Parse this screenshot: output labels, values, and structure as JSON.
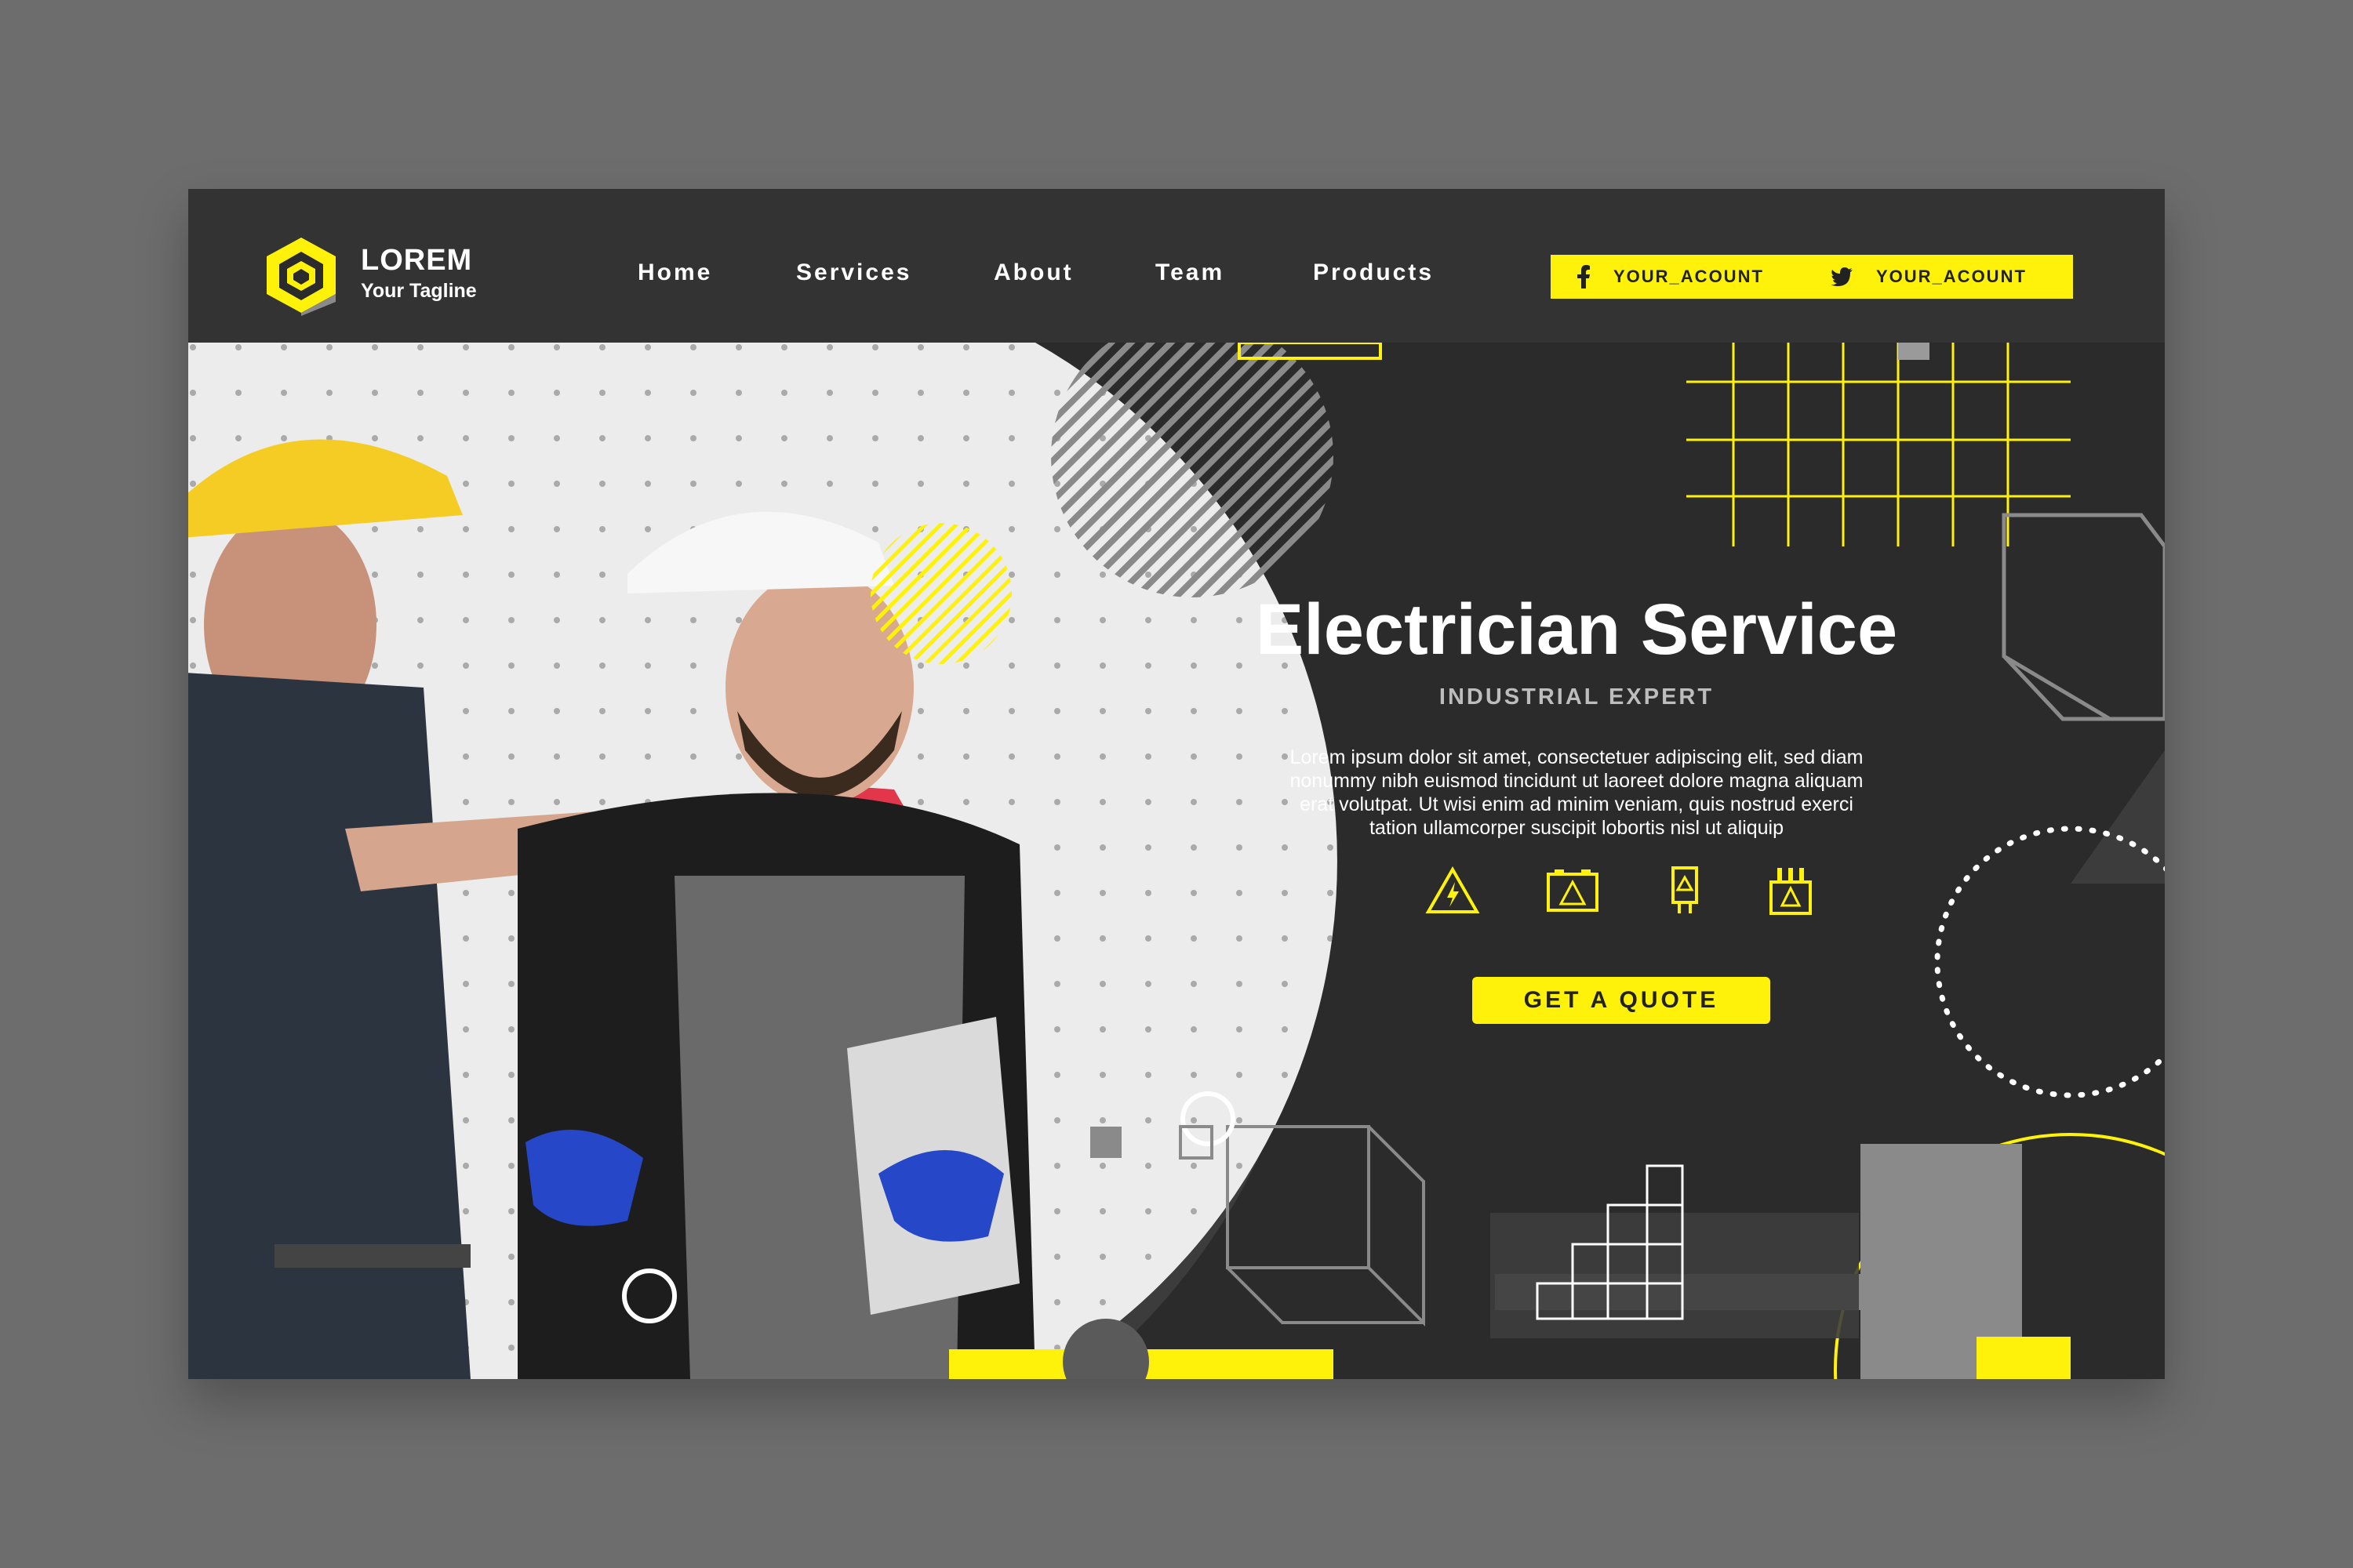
{
  "brand": {
    "name": "LOREM",
    "tagline": "Your Tagline"
  },
  "nav": {
    "items": [
      {
        "label": "Home"
      },
      {
        "label": "Services"
      },
      {
        "label": "About"
      },
      {
        "label": "Team"
      },
      {
        "label": "Products"
      }
    ]
  },
  "social": {
    "facebook": {
      "label": "YOUR_ACOUNT",
      "icon": "facebook-icon"
    },
    "twitter": {
      "label": "YOUR_ACOUNT",
      "icon": "twitter-icon"
    }
  },
  "hero": {
    "title": "Electrician Service",
    "subtitle": "INDUSTRIAL EXPERT",
    "body": "Lorem ipsum dolor sit amet, consectetuer adipiscing elit, sed diam nonummy nibh euismod tincidunt ut laoreet dolore magna aliquam erat volutpat. Ut wisi enim ad minim veniam, quis nostrud exerci tation ullamcorper suscipit lobortis nisl ut aliquip",
    "cta_label": "GET A QUOTE",
    "icons": [
      "high-voltage-warning-icon",
      "battery-warning-icon",
      "electric-meter-icon",
      "transformer-icon"
    ]
  },
  "colors": {
    "accent": "#fff20a",
    "background": "#2b2b2b",
    "header": "#333333",
    "page": "#6d6d6d"
  }
}
